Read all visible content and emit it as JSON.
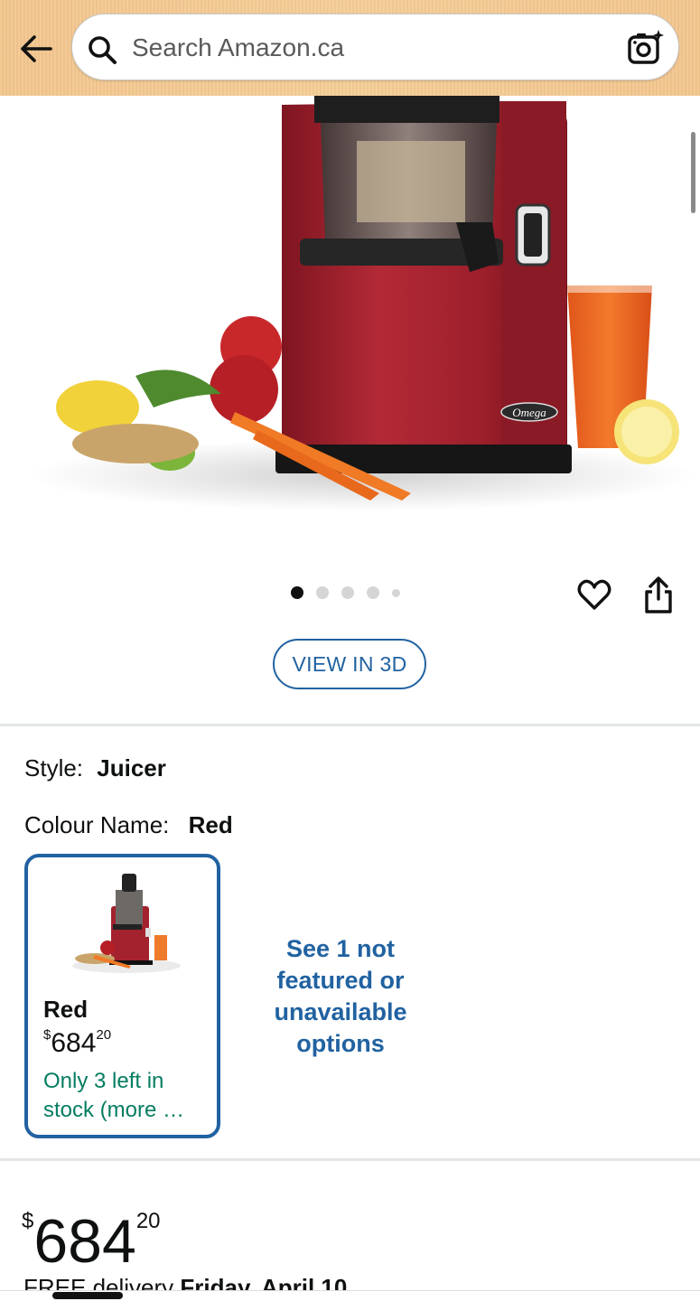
{
  "header": {
    "back_icon": "back-arrow-icon",
    "search_placeholder": "Search Amazon.ca",
    "search_icon": "search-icon",
    "camera_icon": "camera-sparkle-icon"
  },
  "gallery": {
    "image_brand": "Omega",
    "dots_total": 5,
    "active_dot": 0,
    "view_3d_label": "VIEW IN 3D"
  },
  "options": {
    "style_label": "Style:",
    "style_value": "Juicer",
    "colour_label": "Colour Name:",
    "colour_value": "Red",
    "variant": {
      "name": "Red",
      "price_currency": "$",
      "price_dollars": "684",
      "price_cents": "20",
      "stock": "Only 3 left in stock (more …"
    },
    "unavailable_link": "See 1 not featured or unavailable options"
  },
  "buybox": {
    "currency": "$",
    "dollars": "684",
    "cents": "20",
    "delivery_prefix": "FREE delivery ",
    "delivery_date": "Friday, April 10"
  },
  "colors": {
    "header_bg": "#f3c890",
    "link_blue": "#2162a1",
    "stock_green": "#067d62",
    "product_red": "#a3222e"
  }
}
